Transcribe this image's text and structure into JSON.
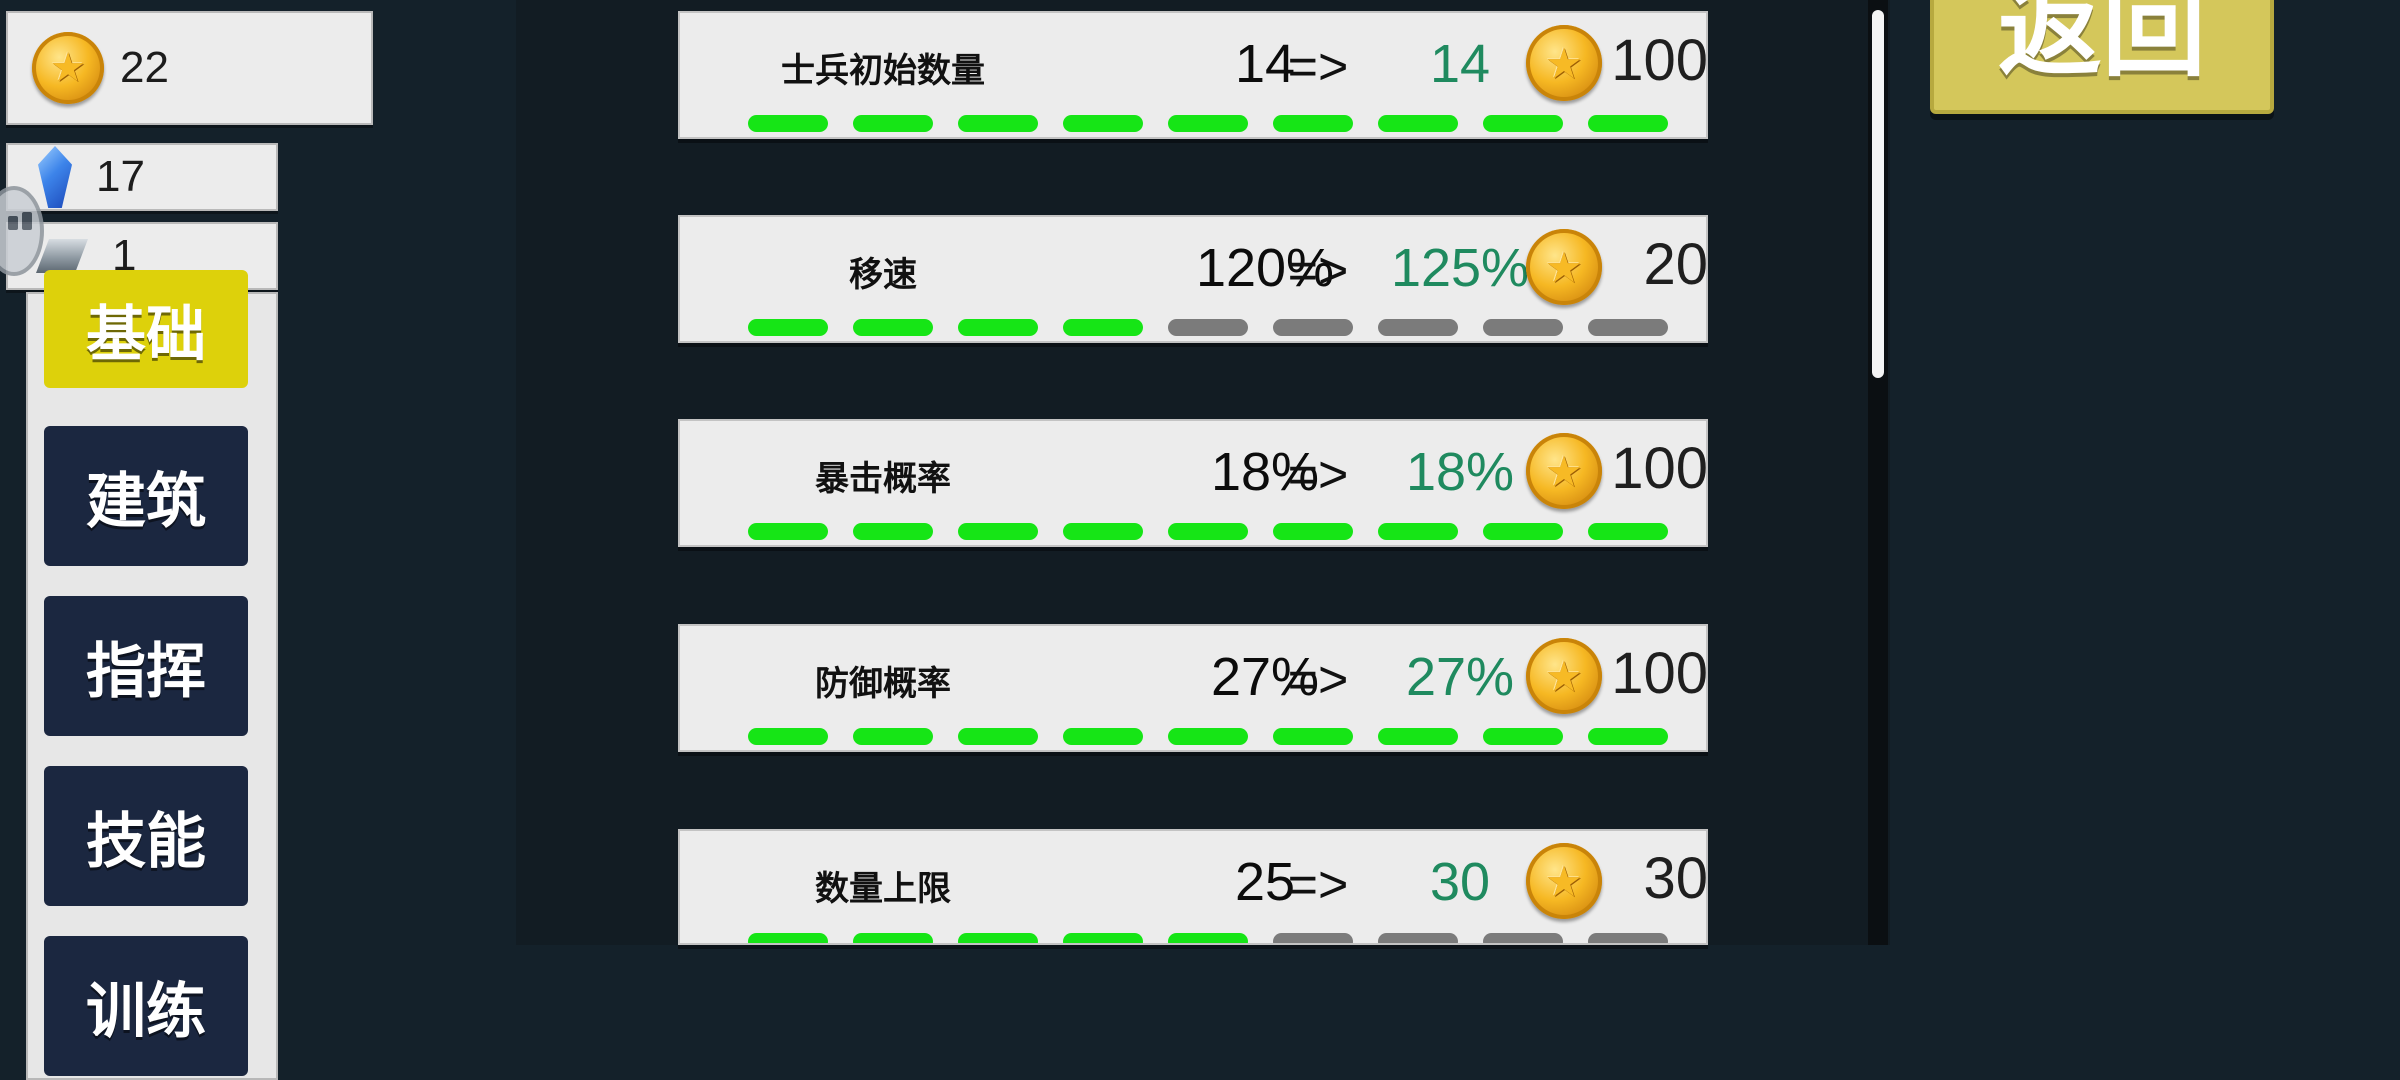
{
  "resources": {
    "gold": {
      "icon": "gold-coin-icon",
      "value": "22"
    },
    "gem": {
      "icon": "blue-gem-icon",
      "value": "17"
    },
    "iron": {
      "icon": "iron-ingot-icon",
      "value": "1"
    }
  },
  "categories": {
    "active": {
      "label": "基础"
    },
    "items": [
      {
        "label": "建筑"
      },
      {
        "label": "指挥"
      },
      {
        "label": "技能"
      },
      {
        "label": "训练"
      }
    ]
  },
  "upgrades": [
    {
      "name": "士兵初始数量",
      "current": "14",
      "arrow": "=>",
      "next": "14",
      "cost": "100",
      "level": 9,
      "max_level": 9
    },
    {
      "name": "移速",
      "current": "120%",
      "arrow": "=>",
      "next": "125%",
      "cost": "20",
      "level": 4,
      "max_level": 9
    },
    {
      "name": "暴击概率",
      "current": "18%",
      "arrow": "=>",
      "next": "18%",
      "cost": "100",
      "level": 9,
      "max_level": 9
    },
    {
      "name": "防御概率",
      "current": "27%",
      "arrow": "=>",
      "next": "27%",
      "cost": "100",
      "level": 9,
      "max_level": 9
    },
    {
      "name": "数量上限",
      "current": "25",
      "arrow": "=>",
      "next": "30",
      "cost": "30",
      "level": 5,
      "max_level": 9
    }
  ],
  "back_button": {
    "label": "返回"
  },
  "colors": {
    "background": "#14212a",
    "active_tab": "#ddd10b",
    "bar_on": "#16e516",
    "bar_off": "#7b7b7b",
    "next_value": "#1f8a5f",
    "back_button": "#d4c75b"
  }
}
